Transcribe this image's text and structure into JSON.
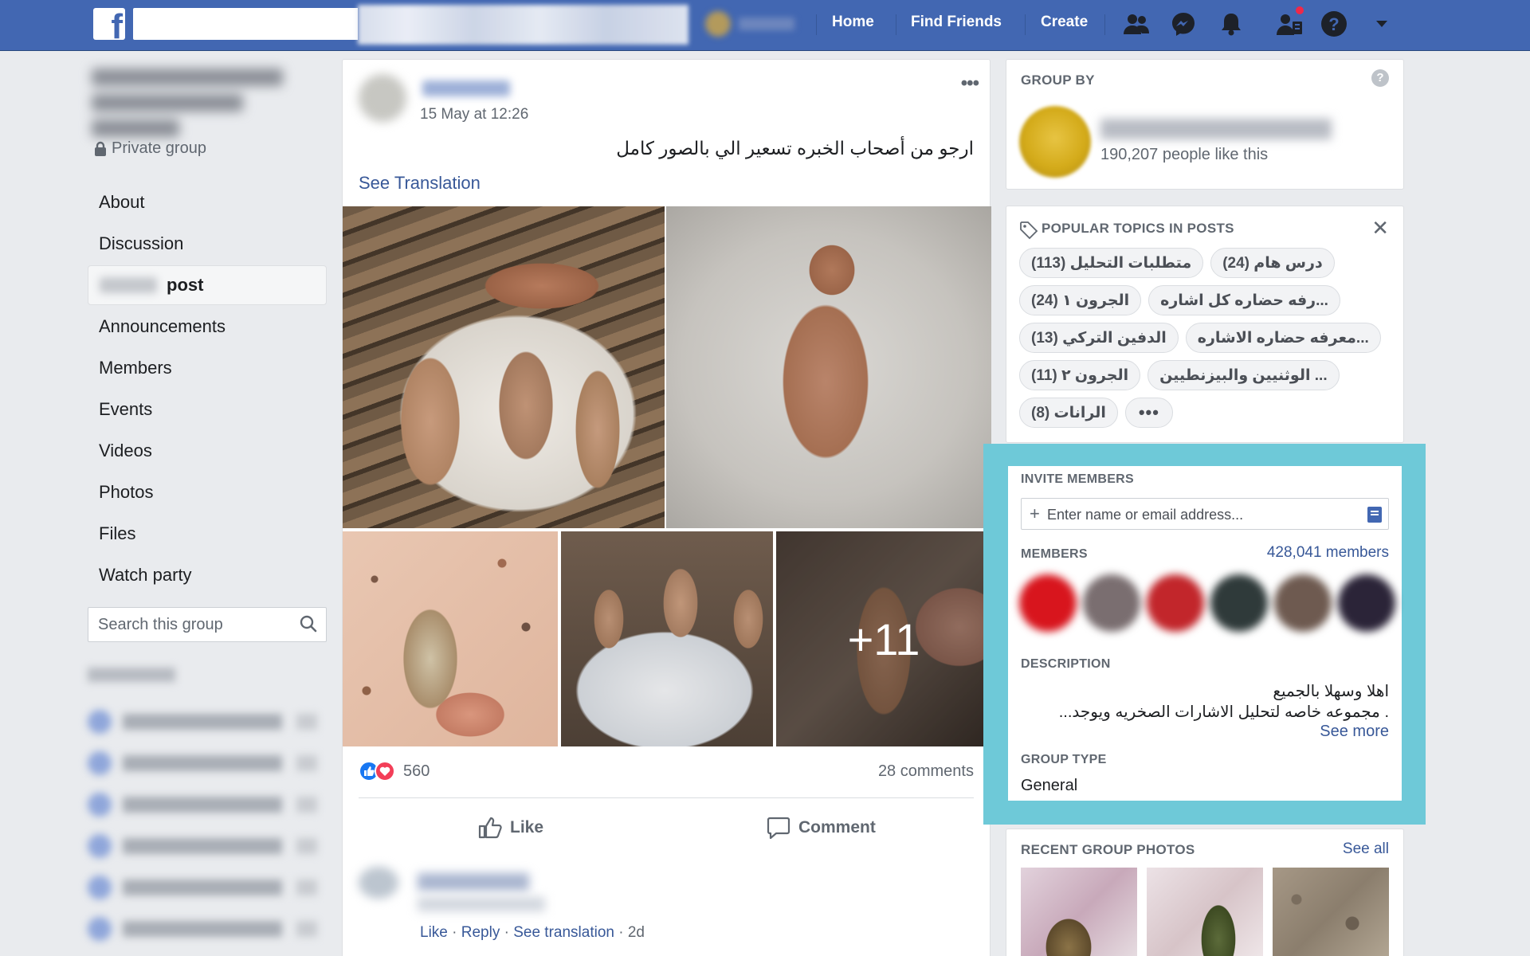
{
  "topbar": {
    "brand_icon": "facebook-f-icon",
    "nav": {
      "home": "Home",
      "find_friends": "Find Friends",
      "create": "Create"
    },
    "icons": [
      "friends-icon",
      "messenger-icon",
      "notifications-bell-icon",
      "friend-requests-icon",
      "help-icon",
      "account-menu-chevron-icon"
    ],
    "colors": {
      "bar": "#4267b2",
      "notification_dot": "#f02849"
    }
  },
  "sidebar": {
    "privacy": "Private group",
    "items": [
      {
        "label": "About"
      },
      {
        "label": "Discussion"
      },
      {
        "label": "post",
        "active": true
      },
      {
        "label": "Announcements"
      },
      {
        "label": "Members"
      },
      {
        "label": "Events"
      },
      {
        "label": "Videos"
      },
      {
        "label": "Photos"
      },
      {
        "label": "Files"
      },
      {
        "label": "Watch party"
      }
    ],
    "search": {
      "placeholder": "Search this group"
    }
  },
  "post": {
    "timestamp": "15 May at 12:26",
    "text": "ارجو من أصحاب الخبره تسعير الي بالصور كامل",
    "see_translation": "See Translation",
    "more_photos": "+11",
    "reactions": {
      "count": "560",
      "types": [
        "like",
        "love"
      ]
    },
    "comments": "28 comments",
    "actions": {
      "like": "Like",
      "comment": "Comment"
    }
  },
  "comment": {
    "actions": {
      "like": "Like",
      "reply": "Reply",
      "see_translation": "See translation",
      "age": "2d"
    }
  },
  "right": {
    "group_by": {
      "title": "GROUP BY",
      "likes": "190,207 people like this"
    },
    "topics": {
      "title": "POPULAR TOPICS IN POSTS",
      "chips": [
        "متطلبات التحليل (113)",
        "درس هام (24)",
        "الجرون ١ (24)",
        "...رفه حضاره كل اشاره",
        "الدفين التركي (13)",
        "...معرفه حضاره الاشاره",
        "الجرون ٢ (11)",
        "... الوثنيين والبيزنطيين",
        "الرانات (8)"
      ],
      "more": "•••"
    },
    "invite": {
      "title": "INVITE MEMBERS",
      "placeholder": "Enter name or email address...",
      "members_title": "MEMBERS",
      "members_count": "428,041 members",
      "description_title": "DESCRIPTION",
      "description_line1": "اهلا وسهلا بالجميع",
      "description_line2": ". مجموعه خاصه لتحليل الاشارات الصخريه ويوجد...",
      "see_more": "See more",
      "group_type_title": "GROUP TYPE",
      "group_type": "General",
      "highlight_color": "#6ec9d8"
    },
    "photos": {
      "title": "RECENT GROUP PHOTOS",
      "see_all": "See all"
    }
  }
}
